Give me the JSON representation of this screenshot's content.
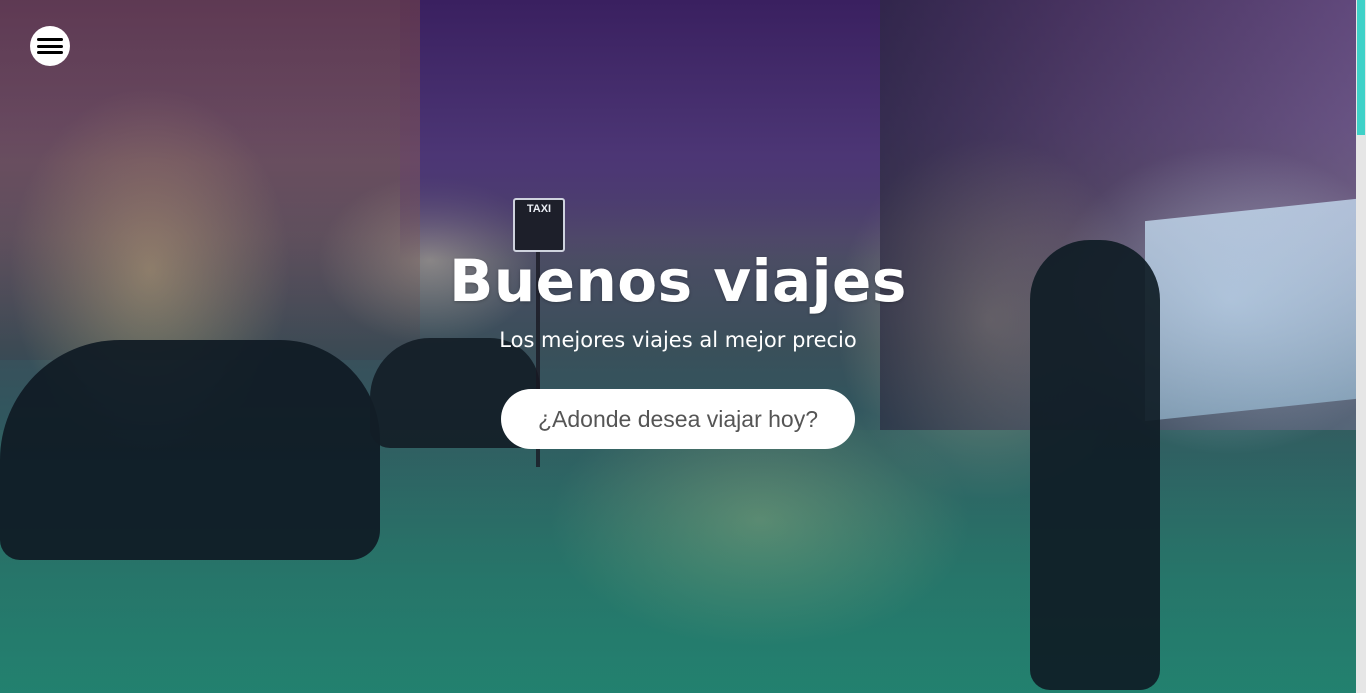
{
  "hero": {
    "title": "Buenos viajes",
    "subtitle": "Los mejores viajes al mejor precio",
    "search": {
      "placeholder": "¿Adonde desea viajar hoy?",
      "value": ""
    },
    "sign_text": "TAXI"
  },
  "menu": {
    "icon": "hamburger-menu-icon"
  },
  "colors": {
    "overlay_top": "#3f2a63",
    "overlay_bottom": "#1e8070",
    "scrollbar_thumb": "#3fd1c8"
  }
}
